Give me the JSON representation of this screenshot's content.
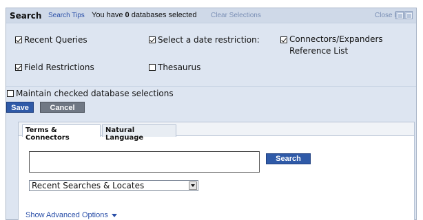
{
  "header": {
    "title": "Search",
    "tips_link": "Search Tips",
    "db_prefix": "You have",
    "db_count": "0",
    "db_suffix": "databases selected",
    "clear_link": "Clear Selections",
    "close_edit_link": "Close Edit",
    "icons": [
      "maximize-icon",
      "close-icon"
    ]
  },
  "options": {
    "recent_queries": {
      "label": "Recent Queries",
      "checked": true
    },
    "date_restriction": {
      "label": "Select a date restriction:",
      "checked": true
    },
    "connectors_line1": "Connectors/Expanders",
    "connectors_line2": "Reference List",
    "connectors_checked": true,
    "field_restrictions": {
      "label": "Field Restrictions",
      "checked": true
    },
    "thesaurus": {
      "label": "Thesaurus",
      "checked": false
    }
  },
  "maintain": {
    "label": "Maintain checked database selections",
    "checked": false
  },
  "actions": {
    "save": "Save",
    "cancel": "Cancel"
  },
  "search": {
    "tabs": [
      "Terms & Connectors",
      "Natural Language"
    ],
    "active_tab": "Terms & Connectors",
    "query_value": "",
    "search_button": "Search",
    "select_value": "Recent Searches & Locates",
    "advanced_link": "Show Advanced Options"
  }
}
